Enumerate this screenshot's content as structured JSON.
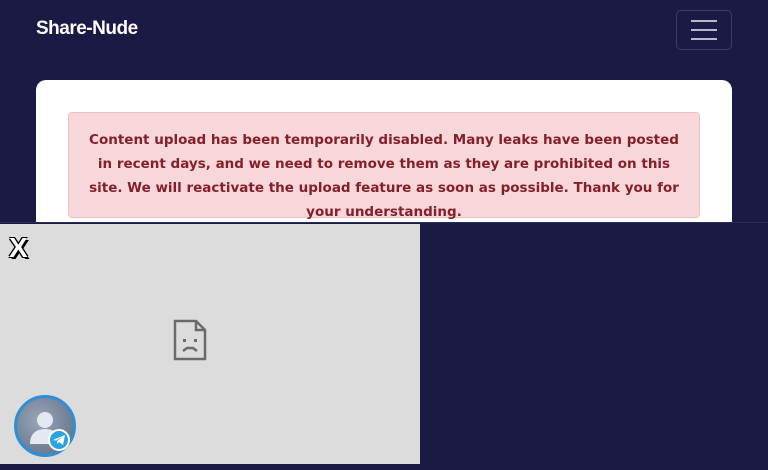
{
  "navbar": {
    "brand": "Share-Nude",
    "toggler_icon": "hamburger-icon"
  },
  "notice": {
    "text": "Content upload has been temporarily disabled. Many leaks have been posted in recent days, and we need to remove them as they are prohibited on this site. We will reactivate the upload feature as soon as possible. Thank you for your understanding."
  },
  "overlay": {
    "close_label": "X",
    "frame_icon": "broken-page-icon",
    "chat_icon": "telegram-icon",
    "avatar_icon": "person-placeholder-icon"
  },
  "colors": {
    "background": "#1a1a44",
    "alert_bg": "#f8d7da",
    "alert_text": "#842029",
    "telegram": "#2aa3e0"
  }
}
